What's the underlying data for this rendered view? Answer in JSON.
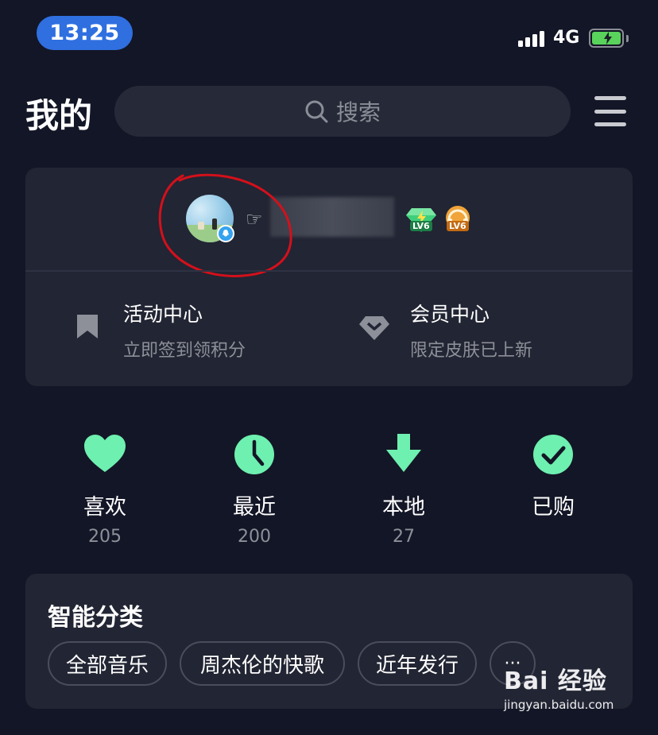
{
  "status_bar": {
    "time": "13:25",
    "network": "4G"
  },
  "header": {
    "title": "我的",
    "search_placeholder": "搜索"
  },
  "profile": {
    "levels": [
      {
        "label": "LV6",
        "kind": "green"
      },
      {
        "label": "LV6",
        "kind": "gold"
      }
    ]
  },
  "entries": [
    {
      "title": "活动中心",
      "subtitle": "立即签到领积分",
      "icon": "bookmark-icon"
    },
    {
      "title": "会员中心",
      "subtitle": "限定皮肤已上新",
      "icon": "diamond-icon"
    }
  ],
  "quick_actions": [
    {
      "label": "喜欢",
      "count": "205",
      "icon": "heart-icon"
    },
    {
      "label": "最近",
      "count": "200",
      "icon": "clock-icon"
    },
    {
      "label": "本地",
      "count": "27",
      "icon": "download-icon"
    },
    {
      "label": "已购",
      "count": "",
      "icon": "check-circle-icon"
    }
  ],
  "smart_category": {
    "title": "智能分类",
    "chips": [
      "全部音乐",
      "周杰伦的快歌",
      "近年发行",
      "···"
    ]
  },
  "watermark": {
    "main": "Bai 经验",
    "sub": "jingyan.baidu.com"
  },
  "colors": {
    "background": "#131626",
    "card": "#222533",
    "accent_green": "#6ef0b0",
    "time_pill": "#2f6fe0",
    "annotation_red": "#d4101b"
  }
}
